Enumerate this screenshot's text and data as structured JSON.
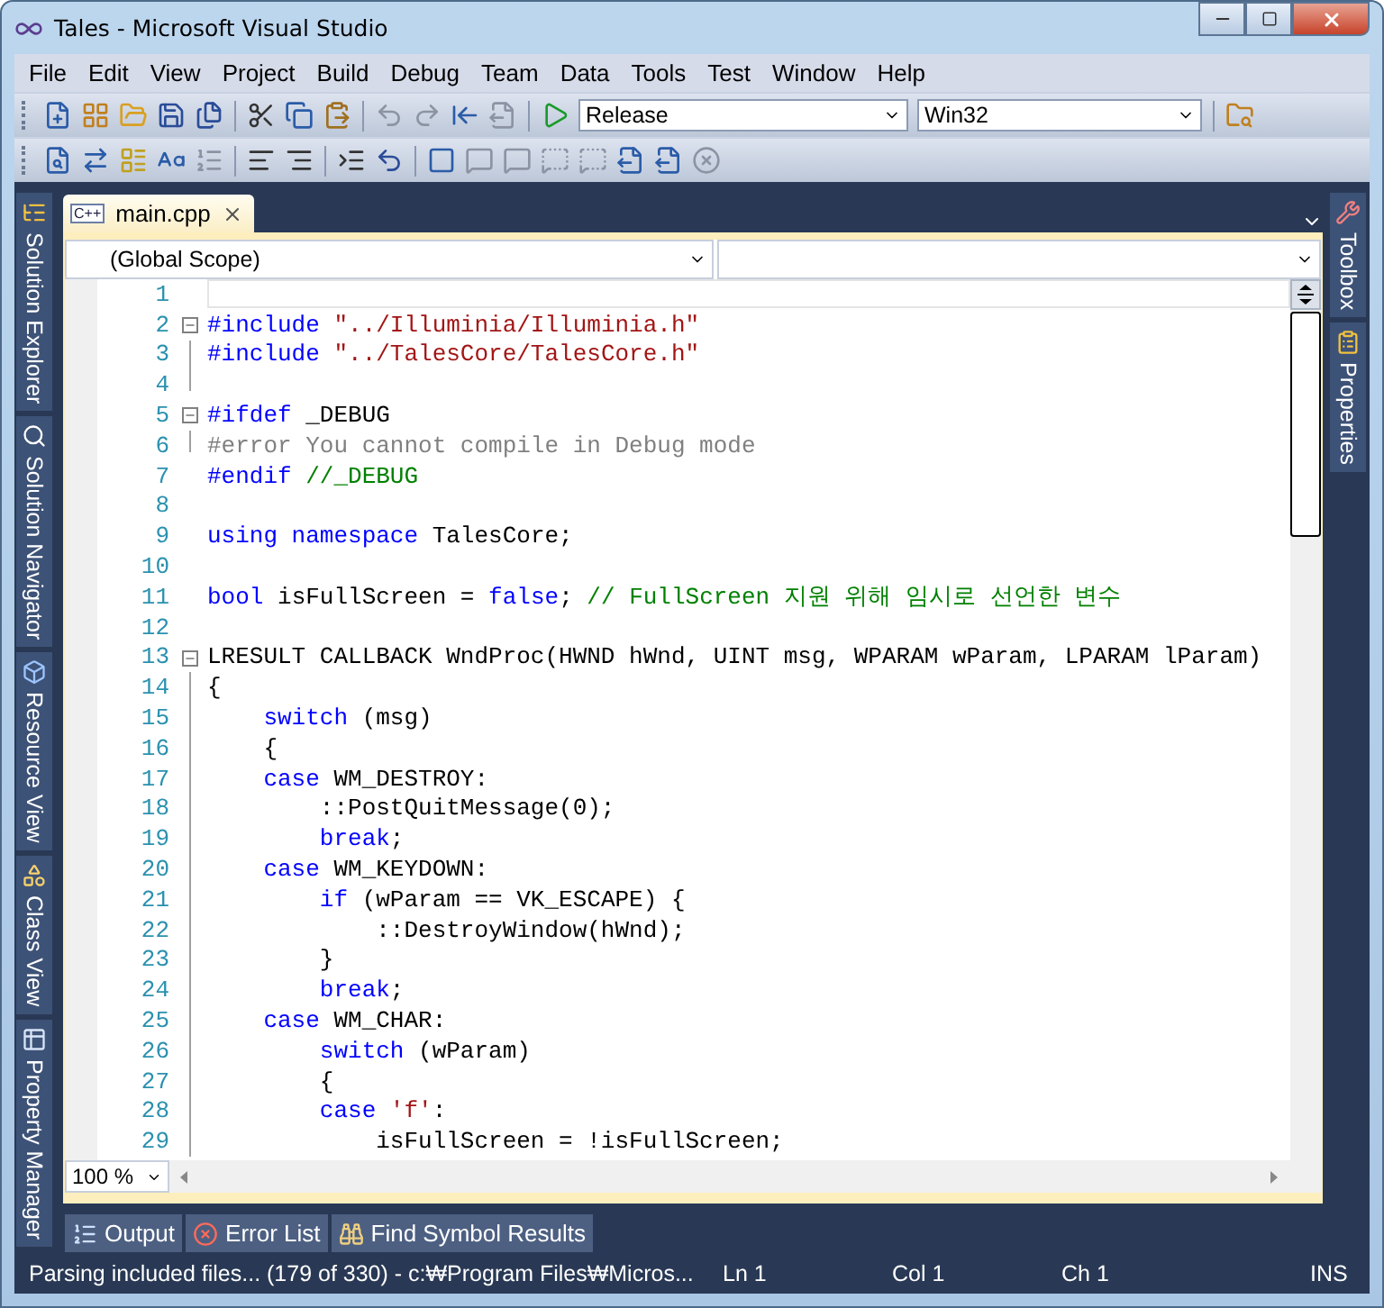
{
  "window": {
    "title": "Tales - Microsoft Visual Studio"
  },
  "menu": [
    "File",
    "Edit",
    "View",
    "Project",
    "Build",
    "Debug",
    "Team",
    "Data",
    "Tools",
    "Test",
    "Window",
    "Help"
  ],
  "toolbar": {
    "configuration": "Release",
    "platform": "Win32"
  },
  "left_tabs": [
    {
      "label": "Solution Explorer",
      "kind": "explorer"
    },
    {
      "label": "Solution Navigator",
      "kind": "search"
    },
    {
      "label": "Resource View",
      "kind": "resource"
    },
    {
      "label": "Class View",
      "kind": "class"
    },
    {
      "label": "Property Manager",
      "kind": "property"
    }
  ],
  "right_tabs": [
    {
      "label": "Toolbox",
      "kind": "toolbox"
    },
    {
      "label": "Properties",
      "kind": "properties"
    }
  ],
  "document_tabs": [
    {
      "label": "main.cpp",
      "badge": "C++",
      "selected": true
    }
  ],
  "scope": "(Global Scope)",
  "code_lines": [
    {
      "number": "1",
      "kind": "current"
    },
    {
      "number": "2",
      "kind": "fold_start",
      "tokens": [
        {
          "kind": "pre",
          "text": "#include "
        },
        {
          "kind": "str",
          "text": "\"../Illuminia/Illuminia.h\""
        }
      ]
    },
    {
      "number": "3",
      "kind": "fold_inner",
      "tokens": [
        {
          "kind": "pre",
          "text": "#include "
        },
        {
          "kind": "str",
          "text": "\"../TalesCore/TalesCore.h\""
        }
      ]
    },
    {
      "number": "4",
      "kind": "fold_end"
    },
    {
      "number": "5",
      "kind": "fold_start",
      "tokens": [
        {
          "kind": "pre",
          "text": "#ifdef"
        },
        {
          "kind": "plain",
          "text": " _DEBUG"
        }
      ]
    },
    {
      "number": "6",
      "kind": "fold_end",
      "tokens": [
        {
          "kind": "gray",
          "text": "#error You cannot compile in Debug mode"
        }
      ]
    },
    {
      "number": "7",
      "kind": "plain",
      "tokens": [
        {
          "kind": "pre",
          "text": "#endif "
        },
        {
          "kind": "cm",
          "text": "//_DEBUG"
        }
      ]
    },
    {
      "number": "8",
      "kind": "plain"
    },
    {
      "number": "9",
      "kind": "plain",
      "tokens": [
        {
          "kind": "kw",
          "text": "using namespace"
        },
        {
          "kind": "plain",
          "text": " TalesCore;"
        }
      ]
    },
    {
      "number": "10",
      "kind": "plain"
    },
    {
      "number": "11",
      "kind": "plain",
      "tokens": [
        {
          "kind": "kw",
          "text": "bool"
        },
        {
          "kind": "plain",
          "text": " isFullScreen = "
        },
        {
          "kind": "kw",
          "text": "false"
        },
        {
          "kind": "plain",
          "text": "; "
        },
        {
          "kind": "cm",
          "text": "// FullScreen 지원 위해 임시로 선언한 변수"
        }
      ]
    },
    {
      "number": "12",
      "kind": "plain"
    },
    {
      "number": "13",
      "kind": "fold_start",
      "tokens": [
        {
          "kind": "plain",
          "text": "LRESULT CALLBACK WndProc(HWND hWnd, UINT msg, WPARAM wParam, LPARAM lParam)"
        }
      ]
    },
    {
      "number": "14",
      "kind": "fold_inner",
      "tokens": [
        {
          "kind": "plain",
          "text": "{"
        }
      ]
    },
    {
      "number": "15",
      "kind": "fold_inner",
      "tokens": [
        {
          "kind": "kw",
          "text": "    switch"
        },
        {
          "kind": "plain",
          "text": " (msg)"
        }
      ]
    },
    {
      "number": "16",
      "kind": "fold_inner",
      "tokens": [
        {
          "kind": "plain",
          "text": "    {"
        }
      ]
    },
    {
      "number": "17",
      "kind": "fold_inner",
      "tokens": [
        {
          "kind": "kw",
          "text": "    case"
        },
        {
          "kind": "plain",
          "text": " WM_DESTROY:"
        }
      ]
    },
    {
      "number": "18",
      "kind": "fold_inner",
      "tokens": [
        {
          "kind": "plain",
          "text": "        ::PostQuitMessage(0);"
        }
      ]
    },
    {
      "number": "19",
      "kind": "fold_inner",
      "tokens": [
        {
          "kind": "kw",
          "text": "        break"
        },
        {
          "kind": "plain",
          "text": ";"
        }
      ]
    },
    {
      "number": "20",
      "kind": "fold_inner",
      "tokens": [
        {
          "kind": "kw",
          "text": "    case"
        },
        {
          "kind": "plain",
          "text": " WM_KEYDOWN:"
        }
      ]
    },
    {
      "number": "21",
      "kind": "fold_inner",
      "tokens": [
        {
          "kind": "kw",
          "text": "        if"
        },
        {
          "kind": "plain",
          "text": " (wParam == VK_ESCAPE) {"
        }
      ]
    },
    {
      "number": "22",
      "kind": "fold_inner",
      "tokens": [
        {
          "kind": "plain",
          "text": "            ::DestroyWindow(hWnd);"
        }
      ]
    },
    {
      "number": "23",
      "kind": "fold_inner",
      "tokens": [
        {
          "kind": "plain",
          "text": "        }"
        }
      ]
    },
    {
      "number": "24",
      "kind": "fold_inner",
      "tokens": [
        {
          "kind": "kw",
          "text": "        break"
        },
        {
          "kind": "plain",
          "text": ";"
        }
      ]
    },
    {
      "number": "25",
      "kind": "fold_inner",
      "tokens": [
        {
          "kind": "kw",
          "text": "    case"
        },
        {
          "kind": "plain",
          "text": " WM_CHAR:"
        }
      ]
    },
    {
      "number": "26",
      "kind": "fold_inner",
      "tokens": [
        {
          "kind": "kw",
          "text": "        switch"
        },
        {
          "kind": "plain",
          "text": " (wParam)"
        }
      ]
    },
    {
      "number": "27",
      "kind": "fold_inner",
      "tokens": [
        {
          "kind": "plain",
          "text": "        {"
        }
      ]
    },
    {
      "number": "28",
      "kind": "fold_inner",
      "tokens": [
        {
          "kind": "kw",
          "text": "        case"
        },
        {
          "kind": "str",
          "text": " 'f'"
        },
        {
          "kind": "plain",
          "text": ":"
        }
      ]
    },
    {
      "number": "29",
      "kind": "fold_inner",
      "tokens": [
        {
          "kind": "plain",
          "text": "            isFullScreen = !isFullScreen;"
        }
      ]
    }
  ],
  "zoom": "100 %",
  "bottom_tabs": [
    {
      "label": "Output",
      "kind": "output"
    },
    {
      "label": "Error List",
      "kind": "error"
    },
    {
      "label": "Find Symbol Results",
      "kind": "find"
    }
  ],
  "status_bar": {
    "message": "Parsing included files... (179 of 330) - c:₩Program Files₩Micros...",
    "line": "Ln 1",
    "column": "Col 1",
    "char": "Ch 1",
    "mode": "INS"
  }
}
